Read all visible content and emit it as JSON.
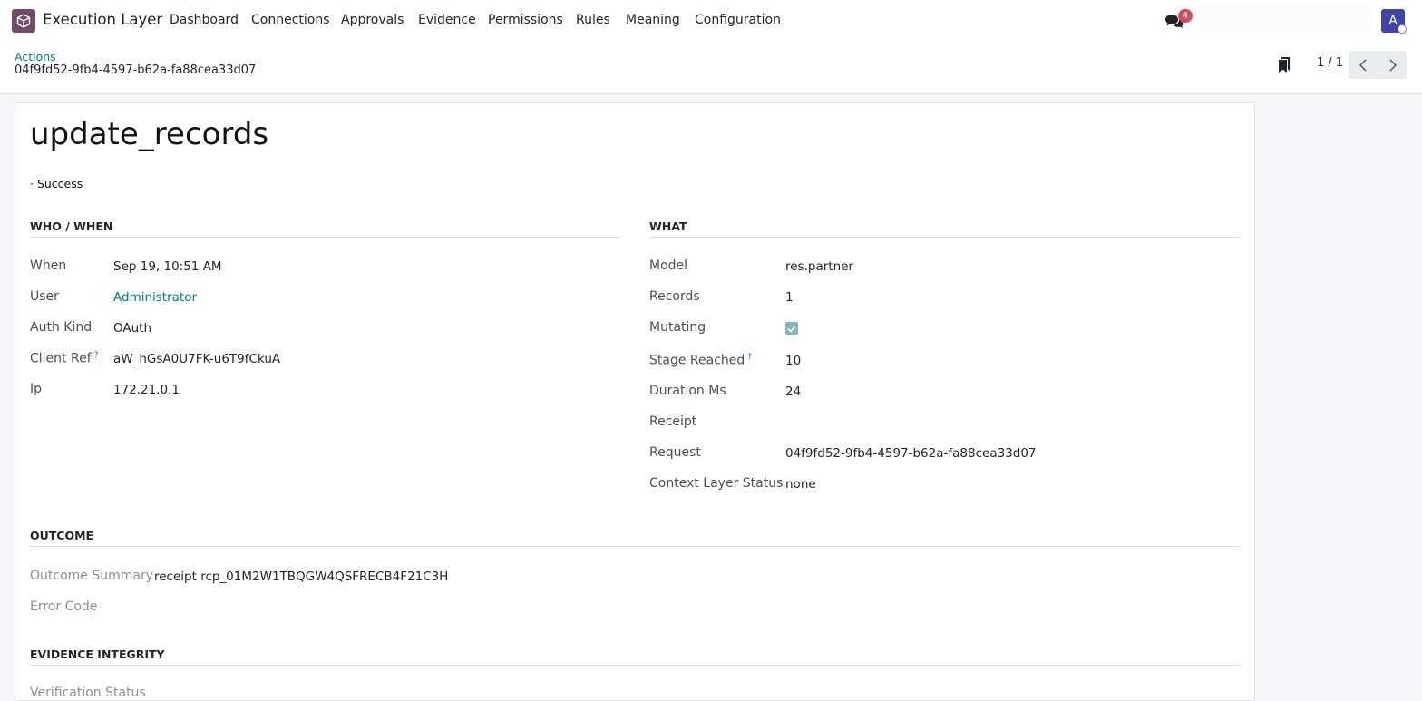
{
  "navbar": {
    "app_name": "Execution Layer",
    "menu": [
      "Dashboard",
      "Connections",
      "Approvals",
      "Evidence",
      "Permissions",
      "Rules",
      "Meaning",
      "Configuration"
    ],
    "chat_badge": "4",
    "avatar_letter": "A"
  },
  "breadcrumb": {
    "parent": "Actions",
    "current": "04f9fd52-9fb4-4597-b62a-fa88cea33d07"
  },
  "pager": {
    "value": "1 / 1"
  },
  "record": {
    "title": "update_records",
    "status": "· Success"
  },
  "sections": {
    "who_when": "WHO / WHEN",
    "what": "WHAT",
    "outcome": "OUTCOME",
    "evidence": "EVIDENCE INTEGRITY"
  },
  "who_when": {
    "when_label": "When",
    "when_value": "Sep 19, 10:51 AM",
    "user_label": "User",
    "user_value": "Administrator",
    "auth_label": "Auth Kind",
    "auth_value": "OAuth",
    "client_label": "Client Ref",
    "client_help": "?",
    "client_value": "aW_hGsA0U7FK-u6T9fCkuA",
    "ip_label": "Ip",
    "ip_value": "172.21.0.1"
  },
  "what": {
    "model_label": "Model",
    "model_value": "res.partner",
    "records_label": "Records",
    "records_value": "1",
    "mutating_label": "Mutating",
    "mutating_checked": true,
    "stage_label": "Stage Reached",
    "stage_help": "?",
    "stage_value": "10",
    "duration_label": "Duration Ms",
    "duration_value": "24",
    "receipt_label": "Receipt",
    "receipt_value": "",
    "request_label": "Request",
    "request_value": "04f9fd52-9fb4-4597-b62a-fa88cea33d07",
    "context_label": "Context Layer Status",
    "context_value": "none"
  },
  "outcome": {
    "summary_label": "Outcome Summary",
    "summary_value": "receipt rcp_01M2W1TBQGW4QSFRECB4F21C3H",
    "error_label": "Error Code",
    "error_value": ""
  },
  "evidence": {
    "verification_label": "Verification Status"
  },
  "colors": {
    "accent": "#017e84",
    "brand": "#714b67",
    "badge": "#d44c59",
    "avatar": "#3f44a8"
  }
}
